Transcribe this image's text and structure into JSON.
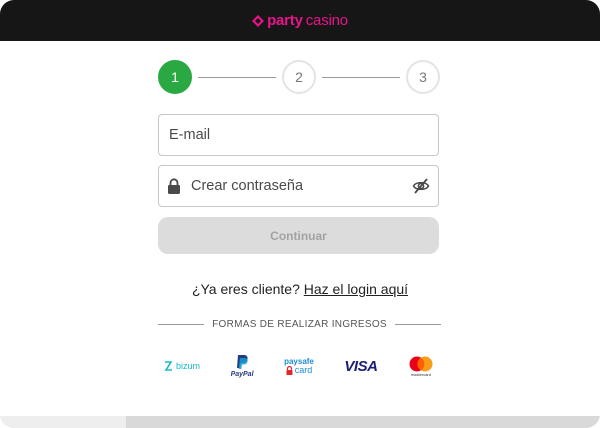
{
  "header": {
    "logo_party": "party",
    "logo_casino": "casino",
    "brand_color": "#e7138a",
    "background": "#161616"
  },
  "stepper": {
    "steps": [
      {
        "label": "1",
        "state": "active"
      },
      {
        "label": "2",
        "state": "inactive"
      },
      {
        "label": "3",
        "state": "inactive"
      }
    ],
    "active_color": "#2aa943"
  },
  "form": {
    "email_placeholder": "E-mail",
    "password_placeholder": "Crear contraseña",
    "continue_label": "Continuar"
  },
  "login": {
    "prompt": "¿Ya eres cliente?",
    "link": "Haz el login aquí"
  },
  "payments": {
    "title": "FORMAS DE REALIZAR INGRESOS",
    "methods": [
      {
        "name": "bizum",
        "label": "bizum",
        "icon": "bizum-logo-icon"
      },
      {
        "name": "paypal",
        "label": "PayPal",
        "icon": "paypal-logo-icon"
      },
      {
        "name": "paysafecard",
        "label_top": "paysafe",
        "label_bottom": "card",
        "icon": "paysafecard-logo-icon"
      },
      {
        "name": "visa",
        "label": "VISA",
        "icon": "visa-logo-icon"
      },
      {
        "name": "mastercard",
        "label": "mastercard",
        "icon": "mastercard-logo-icon"
      }
    ]
  }
}
